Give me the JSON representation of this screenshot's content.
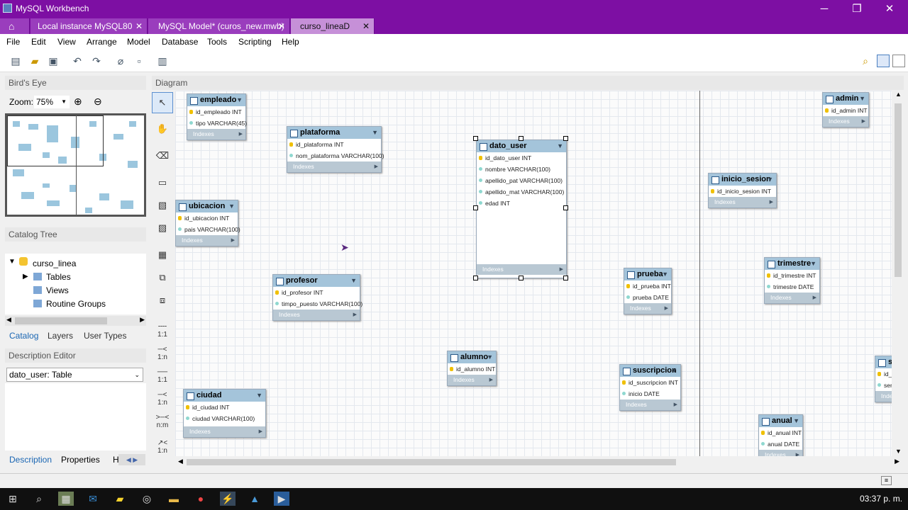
{
  "window": {
    "title": "MySQL Workbench",
    "minimize": "─",
    "maximize": "❐",
    "close": "✕"
  },
  "tabs": [
    {
      "label": "Local instance MySQL80",
      "close": "✕"
    },
    {
      "label": "MySQL Model* (curos_new.mwb)",
      "close": "✕"
    },
    {
      "label": "curso_lineaD",
      "close": "✕"
    }
  ],
  "menu": [
    "File",
    "Edit",
    "View",
    "Arrange",
    "Model",
    "Database",
    "Tools",
    "Scripting",
    "Help"
  ],
  "birdseye": {
    "title": "Bird's Eye",
    "zoom_label": "Zoom:",
    "zoom_value": "75%"
  },
  "catalog": {
    "title": "Catalog Tree",
    "schema": "curso_linea",
    "items": [
      "Tables",
      "Views",
      "Routine Groups"
    ],
    "tabs": [
      "Catalog",
      "Layers",
      "User Types"
    ]
  },
  "description": {
    "title": "Description Editor",
    "selected": "dato_user: Table",
    "tabs": [
      "Description",
      "Properties",
      "H"
    ]
  },
  "diagram": {
    "title": "Diagram"
  },
  "relations": [
    "1:1",
    "1:n",
    "1:1",
    "1:n",
    "n:m",
    "1:n"
  ],
  "entities": [
    {
      "name": "empleado",
      "cols": [
        {
          "t": "id_empleado INT",
          "pk": true
        },
        {
          "t": "tipo VARCHAR(45)",
          "pk": false
        }
      ],
      "idx": "Indexes"
    },
    {
      "name": "plataforma",
      "cols": [
        {
          "t": "id_plataforma INT",
          "pk": true
        },
        {
          "t": "nom_plataforma VARCHAR(100)",
          "pk": false
        }
      ],
      "idx": "Indexes"
    },
    {
      "name": "dato_user",
      "cols": [
        {
          "t": "id_dato_user INT",
          "pk": true
        },
        {
          "t": "nombre VARCHAR(100)",
          "pk": false
        },
        {
          "t": "apellido_pat VARCHAR(100)",
          "pk": false
        },
        {
          "t": "apellido_mat VARCHAR(100)",
          "pk": false
        },
        {
          "t": "edad INT",
          "pk": false
        }
      ],
      "idx": "Indexes"
    },
    {
      "name": "admin",
      "cols": [
        {
          "t": "id_admin INT",
          "pk": true
        }
      ],
      "idx": "Indexes"
    },
    {
      "name": "inicio_sesion",
      "cols": [
        {
          "t": "id_inicio_sesion INT",
          "pk": true
        }
      ],
      "idx": "Indexes"
    },
    {
      "name": "ubicacion",
      "cols": [
        {
          "t": "id_ubicacion INT",
          "pk": true
        },
        {
          "t": "pais VARCHAR(100)",
          "pk": false
        }
      ],
      "idx": "Indexes"
    },
    {
      "name": "profesor",
      "cols": [
        {
          "t": "id_profesor INT",
          "pk": true
        },
        {
          "t": "timpo_puesto VARCHAR(100)",
          "pk": false
        }
      ],
      "idx": "Indexes"
    },
    {
      "name": "prueba",
      "cols": [
        {
          "t": "id_prueba INT",
          "pk": true
        },
        {
          "t": "prueba DATE",
          "pk": false
        }
      ],
      "idx": "Indexes"
    },
    {
      "name": "trimestre",
      "cols": [
        {
          "t": "id_trimestre INT",
          "pk": true
        },
        {
          "t": "trimestre DATE",
          "pk": false
        }
      ],
      "idx": "Indexes"
    },
    {
      "name": "alumno",
      "cols": [
        {
          "t": "id_alumno INT",
          "pk": true
        }
      ],
      "idx": "Indexes"
    },
    {
      "name": "suscripcion",
      "cols": [
        {
          "t": "id_suscripcion INT",
          "pk": true
        },
        {
          "t": "inicio DATE",
          "pk": false
        }
      ],
      "idx": "Indexes"
    },
    {
      "name": "ciudad",
      "cols": [
        {
          "t": "id_ciudad INT",
          "pk": true
        },
        {
          "t": "ciudad VARCHAR(100)",
          "pk": false
        }
      ],
      "idx": "Indexes"
    },
    {
      "name": "anual",
      "cols": [
        {
          "t": "id_anual INT",
          "pk": true
        },
        {
          "t": "anual DATE",
          "pk": false
        }
      ],
      "idx": "Indexes"
    },
    {
      "name": "s",
      "cols": [
        {
          "t": "id_",
          "pk": true
        },
        {
          "t": "ser",
          "pk": false
        }
      ],
      "idx": "Inde"
    }
  ],
  "clock": "03:37 p. m."
}
